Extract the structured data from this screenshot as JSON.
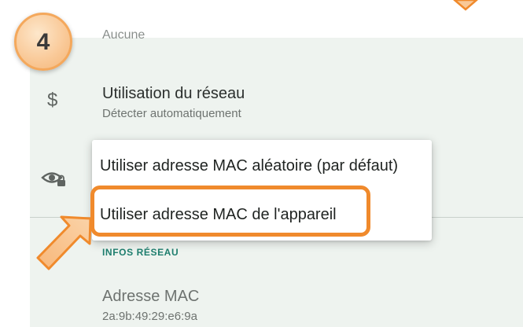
{
  "tutorial": {
    "step_number": "4"
  },
  "settings": {
    "partial_value": "Aucune",
    "network_usage": {
      "title": "Utilisation du réseau",
      "subtitle": "Détecter automatiquement",
      "icon": "dollar-icon"
    },
    "privacy": {
      "icon": "eye-lock-icon"
    },
    "section_header": "INFOS RÉSEAU",
    "mac_address": {
      "title": "Adresse MAC",
      "value": "2a:9b:49:29:e6:9a"
    }
  },
  "dropdown": {
    "options": [
      "Utiliser adresse MAC aléatoire (par défaut)",
      "Utiliser adresse MAC de l'appareil"
    ],
    "highlighted_option": "Utiliser adresse MAC de l'appareil"
  },
  "colors": {
    "accent_teal": "#1e7e6e",
    "highlight_orange": "#f08a2c",
    "panel_background": "#eef3ef"
  }
}
